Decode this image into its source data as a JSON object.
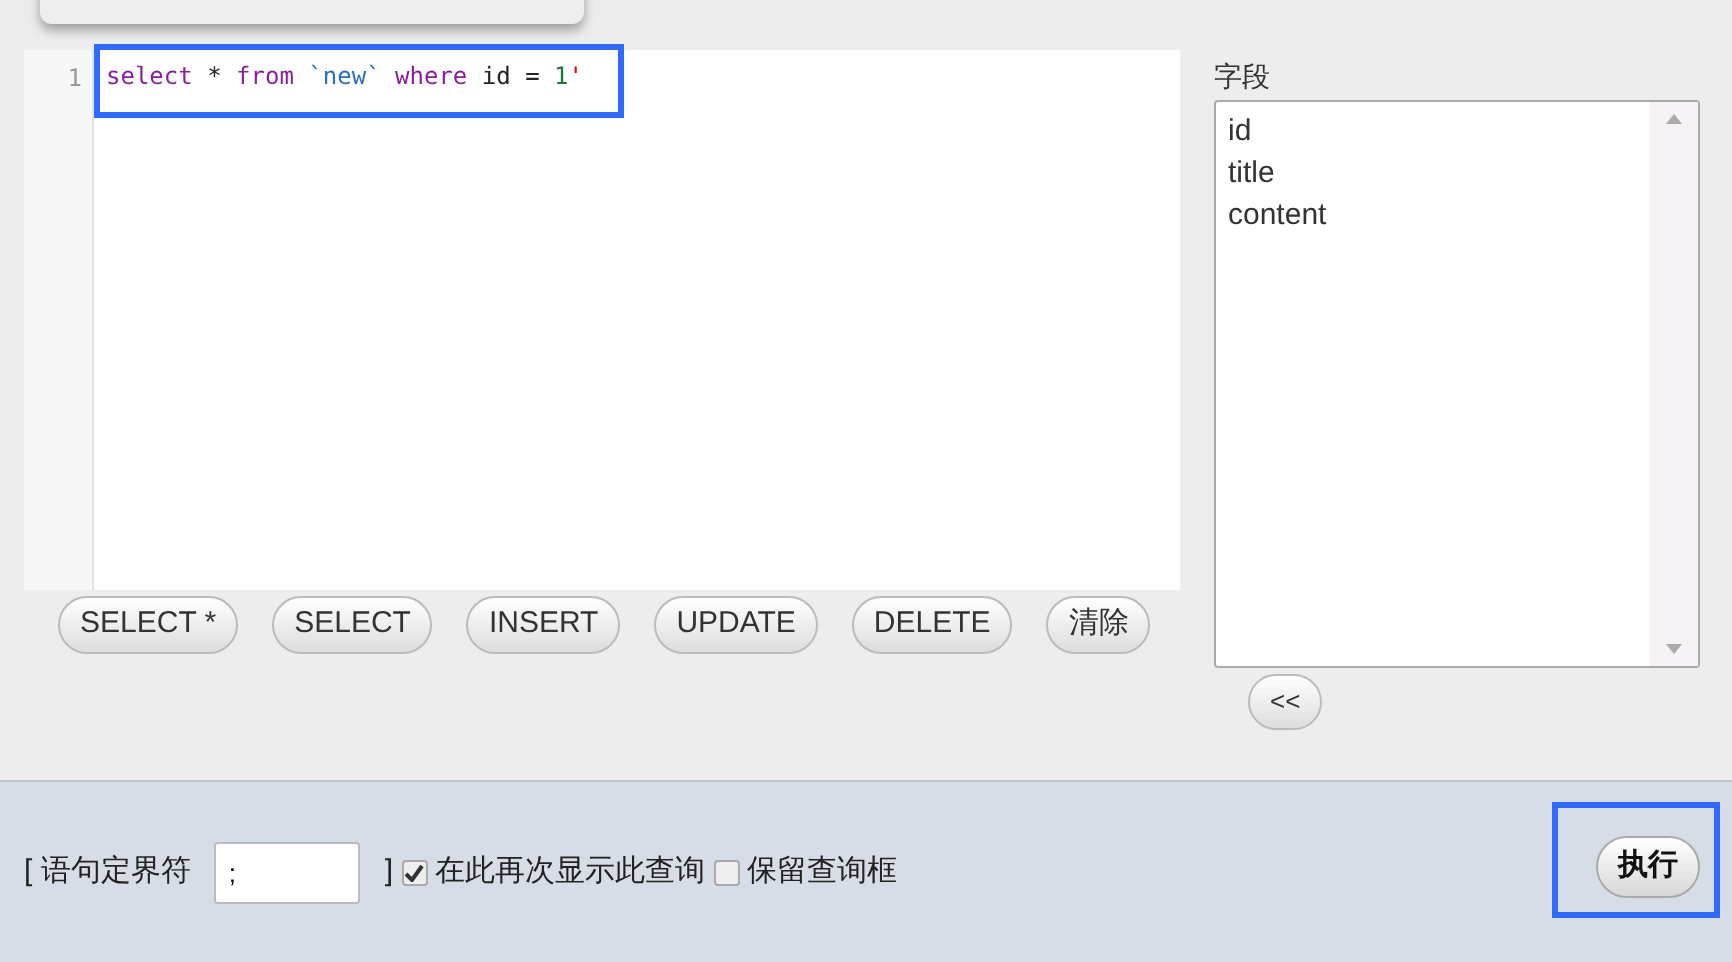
{
  "editor": {
    "line_numbers": [
      "1"
    ],
    "tokens": [
      {
        "kind": "keyword",
        "text": "select"
      },
      {
        "kind": "plain",
        "text": " * "
      },
      {
        "kind": "keyword",
        "text": "from"
      },
      {
        "kind": "identifier",
        "text": " `new`"
      },
      {
        "kind": "keyword",
        "text": " where"
      },
      {
        "kind": "plain",
        "text": " id = "
      },
      {
        "kind": "number",
        "text": "1"
      },
      {
        "kind": "error",
        "text": "'"
      }
    ]
  },
  "query_buttons": [
    "SELECT *",
    "SELECT",
    "INSERT",
    "UPDATE",
    "DELETE",
    "清除"
  ],
  "fields": {
    "label": "字段",
    "items": [
      "id",
      "title",
      "content"
    ],
    "insert_button": "<<"
  },
  "footer": {
    "delimiter_open": "[ 语句定界符",
    "delimiter_value": ";",
    "delimiter_close": "]",
    "options": [
      {
        "label": "在此再次显示此查询",
        "checked": true
      },
      {
        "label": "保留查询框",
        "checked": false
      }
    ],
    "execute_button": "执行"
  }
}
